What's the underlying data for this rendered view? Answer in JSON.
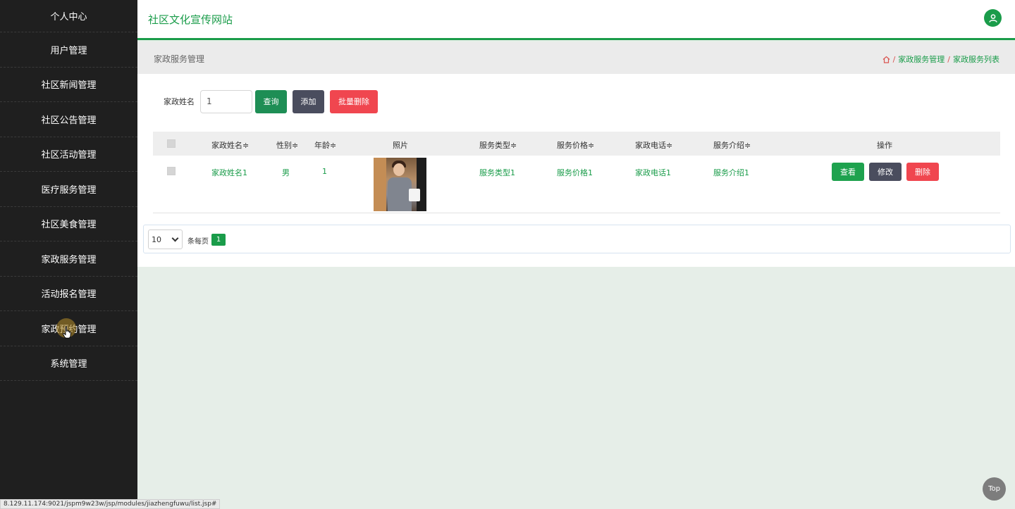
{
  "sidebar": {
    "items": [
      {
        "label": "个人中心"
      },
      {
        "label": "用户管理"
      },
      {
        "label": "社区新闻管理"
      },
      {
        "label": "社区公告管理"
      },
      {
        "label": "社区活动管理"
      },
      {
        "label": "医疗服务管理"
      },
      {
        "label": "社区美食管理"
      },
      {
        "label": "家政服务管理"
      },
      {
        "label": "活动报名管理"
      },
      {
        "label": "家政预约管理"
      },
      {
        "label": "系统管理"
      }
    ]
  },
  "header": {
    "site_title": "社区文化宣传网站",
    "user_icon": "user-icon",
    "accent": "#1a9c4a"
  },
  "breadcrumb": {
    "page_title": "家政服务管理",
    "home_icon": "home-icon",
    "items": [
      "家政服务管理",
      "家政服务列表"
    ],
    "separator": "/"
  },
  "search": {
    "label": "家政姓名",
    "value": "1",
    "query_label": "查询",
    "add_label": "添加",
    "batch_delete_label": "批量删除"
  },
  "table": {
    "columns": [
      "家政姓名",
      "性别",
      "年龄",
      "照片",
      "服务类型",
      "服务价格",
      "家政电话",
      "服务介绍",
      "操作"
    ],
    "sort_mark": "≑",
    "rows": [
      {
        "name": "家政姓名1",
        "gender": "男",
        "age": "1",
        "service_type": "服务类型1",
        "service_price": "服务价格1",
        "phone": "家政电话1",
        "intro": "服务介绍1",
        "actions": {
          "view": "查看",
          "edit": "修改",
          "delete": "删除"
        }
      }
    ]
  },
  "pagination": {
    "page_size": "10",
    "per_page_label": "条每页",
    "current_page": "1"
  },
  "top_button_label": "Top",
  "status_url": "8.129.11.174:9021/jspm9w23w/jsp/modules/jiazhengfuwu/list.jsp#"
}
